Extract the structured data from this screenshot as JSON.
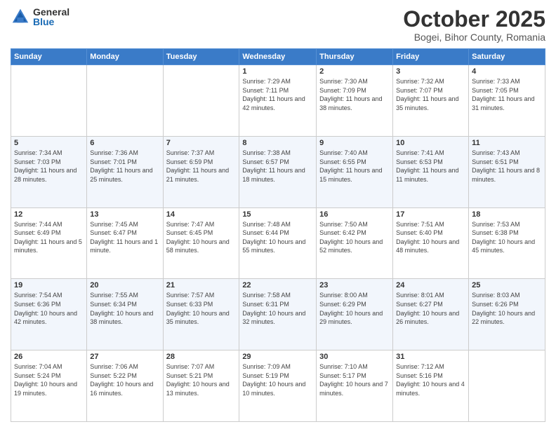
{
  "logo": {
    "general": "General",
    "blue": "Blue"
  },
  "title": "October 2025",
  "location": "Bogei, Bihor County, Romania",
  "days_of_week": [
    "Sunday",
    "Monday",
    "Tuesday",
    "Wednesday",
    "Thursday",
    "Friday",
    "Saturday"
  ],
  "weeks": [
    [
      {
        "day": "",
        "sunrise": "",
        "sunset": "",
        "daylight": ""
      },
      {
        "day": "",
        "sunrise": "",
        "sunset": "",
        "daylight": ""
      },
      {
        "day": "",
        "sunrise": "",
        "sunset": "",
        "daylight": ""
      },
      {
        "day": "1",
        "sunrise": "Sunrise: 7:29 AM",
        "sunset": "Sunset: 7:11 PM",
        "daylight": "Daylight: 11 hours and 42 minutes."
      },
      {
        "day": "2",
        "sunrise": "Sunrise: 7:30 AM",
        "sunset": "Sunset: 7:09 PM",
        "daylight": "Daylight: 11 hours and 38 minutes."
      },
      {
        "day": "3",
        "sunrise": "Sunrise: 7:32 AM",
        "sunset": "Sunset: 7:07 PM",
        "daylight": "Daylight: 11 hours and 35 minutes."
      },
      {
        "day": "4",
        "sunrise": "Sunrise: 7:33 AM",
        "sunset": "Sunset: 7:05 PM",
        "daylight": "Daylight: 11 hours and 31 minutes."
      }
    ],
    [
      {
        "day": "5",
        "sunrise": "Sunrise: 7:34 AM",
        "sunset": "Sunset: 7:03 PM",
        "daylight": "Daylight: 11 hours and 28 minutes."
      },
      {
        "day": "6",
        "sunrise": "Sunrise: 7:36 AM",
        "sunset": "Sunset: 7:01 PM",
        "daylight": "Daylight: 11 hours and 25 minutes."
      },
      {
        "day": "7",
        "sunrise": "Sunrise: 7:37 AM",
        "sunset": "Sunset: 6:59 PM",
        "daylight": "Daylight: 11 hours and 21 minutes."
      },
      {
        "day": "8",
        "sunrise": "Sunrise: 7:38 AM",
        "sunset": "Sunset: 6:57 PM",
        "daylight": "Daylight: 11 hours and 18 minutes."
      },
      {
        "day": "9",
        "sunrise": "Sunrise: 7:40 AM",
        "sunset": "Sunset: 6:55 PM",
        "daylight": "Daylight: 11 hours and 15 minutes."
      },
      {
        "day": "10",
        "sunrise": "Sunrise: 7:41 AM",
        "sunset": "Sunset: 6:53 PM",
        "daylight": "Daylight: 11 hours and 11 minutes."
      },
      {
        "day": "11",
        "sunrise": "Sunrise: 7:43 AM",
        "sunset": "Sunset: 6:51 PM",
        "daylight": "Daylight: 11 hours and 8 minutes."
      }
    ],
    [
      {
        "day": "12",
        "sunrise": "Sunrise: 7:44 AM",
        "sunset": "Sunset: 6:49 PM",
        "daylight": "Daylight: 11 hours and 5 minutes."
      },
      {
        "day": "13",
        "sunrise": "Sunrise: 7:45 AM",
        "sunset": "Sunset: 6:47 PM",
        "daylight": "Daylight: 11 hours and 1 minute."
      },
      {
        "day": "14",
        "sunrise": "Sunrise: 7:47 AM",
        "sunset": "Sunset: 6:45 PM",
        "daylight": "Daylight: 10 hours and 58 minutes."
      },
      {
        "day": "15",
        "sunrise": "Sunrise: 7:48 AM",
        "sunset": "Sunset: 6:44 PM",
        "daylight": "Daylight: 10 hours and 55 minutes."
      },
      {
        "day": "16",
        "sunrise": "Sunrise: 7:50 AM",
        "sunset": "Sunset: 6:42 PM",
        "daylight": "Daylight: 10 hours and 52 minutes."
      },
      {
        "day": "17",
        "sunrise": "Sunrise: 7:51 AM",
        "sunset": "Sunset: 6:40 PM",
        "daylight": "Daylight: 10 hours and 48 minutes."
      },
      {
        "day": "18",
        "sunrise": "Sunrise: 7:53 AM",
        "sunset": "Sunset: 6:38 PM",
        "daylight": "Daylight: 10 hours and 45 minutes."
      }
    ],
    [
      {
        "day": "19",
        "sunrise": "Sunrise: 7:54 AM",
        "sunset": "Sunset: 6:36 PM",
        "daylight": "Daylight: 10 hours and 42 minutes."
      },
      {
        "day": "20",
        "sunrise": "Sunrise: 7:55 AM",
        "sunset": "Sunset: 6:34 PM",
        "daylight": "Daylight: 10 hours and 38 minutes."
      },
      {
        "day": "21",
        "sunrise": "Sunrise: 7:57 AM",
        "sunset": "Sunset: 6:33 PM",
        "daylight": "Daylight: 10 hours and 35 minutes."
      },
      {
        "day": "22",
        "sunrise": "Sunrise: 7:58 AM",
        "sunset": "Sunset: 6:31 PM",
        "daylight": "Daylight: 10 hours and 32 minutes."
      },
      {
        "day": "23",
        "sunrise": "Sunrise: 8:00 AM",
        "sunset": "Sunset: 6:29 PM",
        "daylight": "Daylight: 10 hours and 29 minutes."
      },
      {
        "day": "24",
        "sunrise": "Sunrise: 8:01 AM",
        "sunset": "Sunset: 6:27 PM",
        "daylight": "Daylight: 10 hours and 26 minutes."
      },
      {
        "day": "25",
        "sunrise": "Sunrise: 8:03 AM",
        "sunset": "Sunset: 6:26 PM",
        "daylight": "Daylight: 10 hours and 22 minutes."
      }
    ],
    [
      {
        "day": "26",
        "sunrise": "Sunrise: 7:04 AM",
        "sunset": "Sunset: 5:24 PM",
        "daylight": "Daylight: 10 hours and 19 minutes."
      },
      {
        "day": "27",
        "sunrise": "Sunrise: 7:06 AM",
        "sunset": "Sunset: 5:22 PM",
        "daylight": "Daylight: 10 hours and 16 minutes."
      },
      {
        "day": "28",
        "sunrise": "Sunrise: 7:07 AM",
        "sunset": "Sunset: 5:21 PM",
        "daylight": "Daylight: 10 hours and 13 minutes."
      },
      {
        "day": "29",
        "sunrise": "Sunrise: 7:09 AM",
        "sunset": "Sunset: 5:19 PM",
        "daylight": "Daylight: 10 hours and 10 minutes."
      },
      {
        "day": "30",
        "sunrise": "Sunrise: 7:10 AM",
        "sunset": "Sunset: 5:17 PM",
        "daylight": "Daylight: 10 hours and 7 minutes."
      },
      {
        "day": "31",
        "sunrise": "Sunrise: 7:12 AM",
        "sunset": "Sunset: 5:16 PM",
        "daylight": "Daylight: 10 hours and 4 minutes."
      },
      {
        "day": "",
        "sunrise": "",
        "sunset": "",
        "daylight": ""
      }
    ]
  ]
}
